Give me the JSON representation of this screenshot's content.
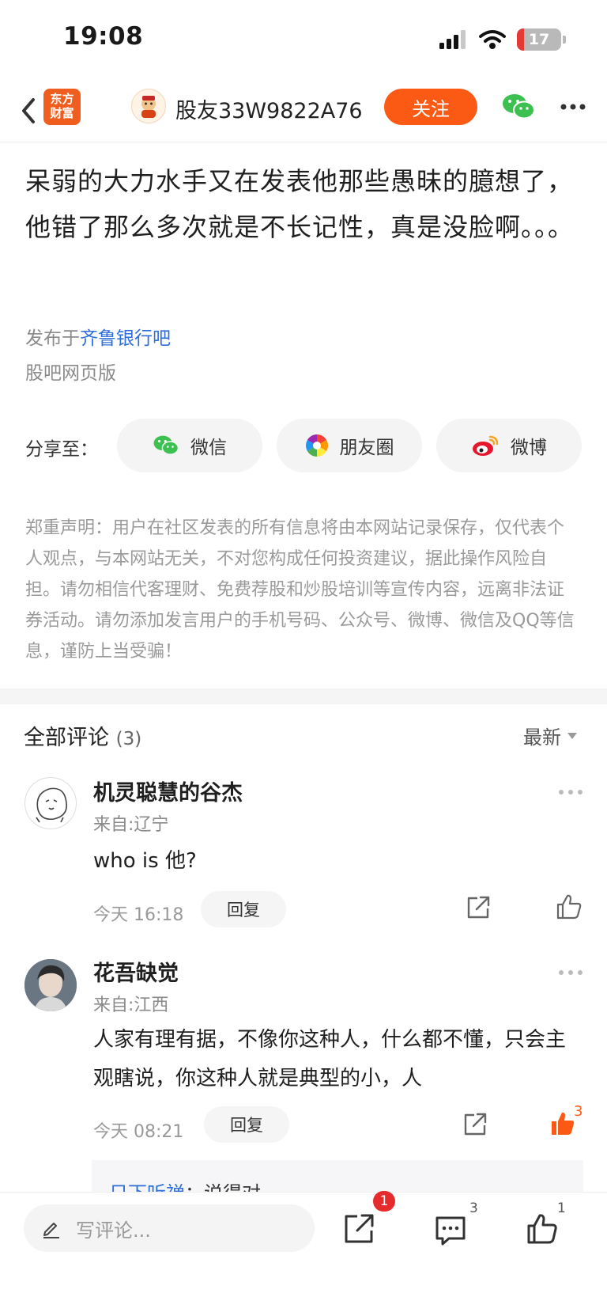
{
  "status_bar": {
    "time": "19:08",
    "battery": "17"
  },
  "nav": {
    "logo_line1": "东方",
    "logo_line2": "财富",
    "username": "股友33W9822A76",
    "follow_label": "关注"
  },
  "post": {
    "content": "呆弱的大力水手又在发表他那些愚昧的臆想了，他错了那么多次就是不长记性，真是没脸啊。。。",
    "published_prefix": "发布于",
    "forum_name": "齐鲁银行吧",
    "source": "股吧网页版"
  },
  "share": {
    "label": "分享至：",
    "wechat": "微信",
    "moments": "朋友圈",
    "weibo": "微博"
  },
  "disclaimer": "郑重声明：用户在社区发表的所有信息将由本网站记录保存，仅代表个人观点，与本网站无关，不对您构成任何投资建议，据此操作风险自担。请勿相信代客理财、免费荐股和炒股培训等宣传内容，远离非法证券活动。请勿添加发言用户的手机号码、公众号、微博、微信及QQ等信息，谨防上当受骗！",
  "comments_header": {
    "title": "全部评论",
    "count": "(3)",
    "sort_label": "最新"
  },
  "comments": [
    {
      "name": "机灵聪慧的谷杰",
      "location": "来自:辽宁",
      "text": "who is 他?",
      "time": "今天 16:18",
      "reply_label": "回复",
      "likes": ""
    },
    {
      "name": "花吾缺觉",
      "location": "来自:江西",
      "text": "人家有理有据，不像你这种人，什么都不懂，只会主观瞎说，你这种人就是典型的小，人",
      "time": "今天 08:21",
      "reply_label": "回复",
      "likes": "3"
    }
  ],
  "subreply": {
    "user": "日下听禅",
    "separator": "：",
    "text": "说得对"
  },
  "bottom_bar": {
    "input_placeholder": "写评论...",
    "share_badge": "1",
    "comment_count": "3",
    "like_count": "1"
  },
  "colors": {
    "accent": "#fa5a14",
    "link": "#2f6fdb",
    "badge": "#e52b2b"
  }
}
